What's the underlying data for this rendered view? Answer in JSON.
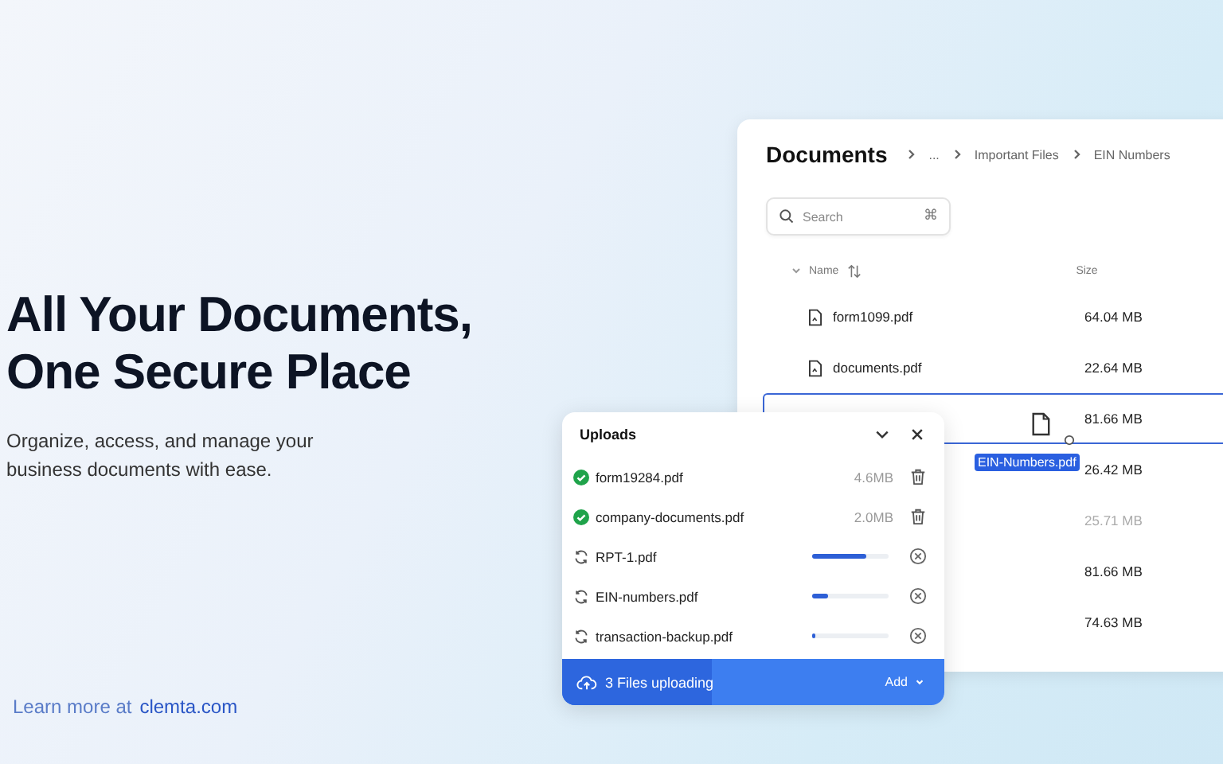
{
  "hero": {
    "title_lines": [
      "All Your Documents,",
      "One Secure Place"
    ],
    "subtitle": "Organize, access, and manage your business documents with ease.",
    "learn_more": "Learn more at",
    "link": "clemta.com"
  },
  "documents": {
    "title": "Documents",
    "breadcrumbs": [
      "...",
      "Important Files",
      "EIN Numbers"
    ],
    "search": {
      "placeholder": "Search",
      "shortcut": "⌘"
    },
    "columns": [
      "Name",
      "Size"
    ],
    "rows": [
      {
        "name": "form1099.pdf",
        "size": "64.04 MB",
        "selected": false,
        "dimmed": false
      },
      {
        "name": "documents.pdf",
        "size": "22.64 MB",
        "selected": false,
        "dimmed": false
      },
      {
        "size": "81.66 MB",
        "selected": true,
        "dimmed": false
      },
      {
        "size": "26.42 MB",
        "selected": false,
        "dimmed": false
      },
      {
        "size": "25.71 MB",
        "selected": false,
        "dimmed": true
      },
      {
        "size": "81.66 MB",
        "selected": false,
        "dimmed": false
      },
      {
        "size": "74.63 MB",
        "selected": false,
        "dimmed": false
      }
    ],
    "drag_label": "EIN-Numbers.pdf"
  },
  "uploads": {
    "title": "Uploads",
    "items": [
      {
        "kind": "done",
        "name": "form19284.pdf",
        "size": "4.6MB"
      },
      {
        "kind": "done",
        "name": "company-documents.pdf",
        "size": "2.0MB"
      },
      {
        "kind": "uploading",
        "name": "RPT-1.pdf",
        "level": 0.7
      },
      {
        "kind": "uploading",
        "name": "EIN-numbers.pdf",
        "level": 0.2
      },
      {
        "kind": "uploading",
        "name": "transaction-backup.pdf",
        "level": 0.05
      }
    ],
    "footer": {
      "status": "3 Files uploading",
      "level": 0.39,
      "action": "Add"
    }
  }
}
